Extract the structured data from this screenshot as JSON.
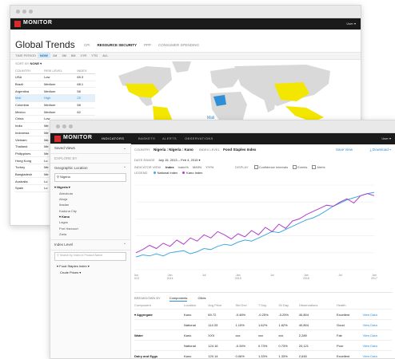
{
  "back": {
    "brand": "MONITOR",
    "user": "User ▾",
    "title": "Global Trends",
    "tabs": [
      "CPI",
      "RESOURCE SECURITY",
      "PPP",
      "CONSUMER SPENDING"
    ],
    "active_tab": "RESOURCE SECURITY",
    "time_label": "TIME PERIOD",
    "periods": [
      "NOW",
      "1M",
      "3M",
      "6M",
      "1YR",
      "YTD",
      "ALL"
    ],
    "sort_label": "SORT BY",
    "sort_value": "NONE ▾",
    "col_headers": [
      "COUNTRY",
      "RISK LEVEL",
      "INDEX"
    ],
    "rows": [
      {
        "country": "USA",
        "risk": "Low",
        "index": "69.3"
      },
      {
        "country": "Brazil",
        "risk": "Medium",
        "index": "68.1"
      },
      {
        "country": "Argentina",
        "risk": "Medium",
        "index": "58"
      },
      {
        "country": "Mali",
        "risk": "High",
        "index": "25"
      },
      {
        "country": "Colombia",
        "risk": "Medium",
        "index": "58"
      },
      {
        "country": "Mexico",
        "risk": "Medium",
        "index": "62"
      },
      {
        "country": "China",
        "risk": "Low",
        "index": ""
      },
      {
        "country": "India",
        "risk": "Me",
        "index": ""
      },
      {
        "country": "Indonesia",
        "risk": "Me",
        "index": ""
      },
      {
        "country": "Vietnam",
        "risk": "Me",
        "index": ""
      },
      {
        "country": "Thailand",
        "risk": "Me",
        "index": ""
      },
      {
        "country": "Philippines",
        "risk": "Me",
        "index": ""
      },
      {
        "country": "Hong Kong",
        "risk": "Lo",
        "index": ""
      },
      {
        "country": "Turkey",
        "risk": "Me",
        "index": ""
      },
      {
        "country": "Bangladesh",
        "risk": "Me",
        "index": ""
      },
      {
        "country": "Australia",
        "risk": "Lo",
        "index": ""
      },
      {
        "country": "Spain",
        "risk": "Lo",
        "index": ""
      }
    ],
    "map_label": "Mali"
  },
  "front": {
    "brand": "MONITOR",
    "nav": [
      "INDICATORS",
      "BASKETS",
      "ALERTS",
      "OBSERVATIONS"
    ],
    "active_nav": "INDICATORS",
    "user": "User ▾",
    "saved_views": "Saved Views",
    "explore_by": "EXPLORE BY",
    "geo_title": "Geographic Location",
    "geo_search": "Nigeria",
    "tree": [
      {
        "label": "▾ Nigeria ▾",
        "level": 0
      },
      {
        "label": "Abeokuta",
        "level": 1
      },
      {
        "label": "Abuja",
        "level": 1
      },
      {
        "label": "Ibadan",
        "level": 1
      },
      {
        "label": "Kaduna City",
        "level": 1
      },
      {
        "label": "▾ Kano",
        "level": 1
      },
      {
        "label": "Lagos",
        "level": 1
      },
      {
        "label": "Port Harcourt",
        "level": 1
      },
      {
        "label": "Zaria",
        "level": 1
      }
    ],
    "index_title": "Index Level",
    "index_search": "Search by Index in Product Name",
    "index_items": [
      "▾ Food Staples Index ▾",
      "Crude Prices ▾"
    ],
    "country_label": "COUNTRY",
    "country_value": "Nigeria : Nigeria : Kano",
    "index_label": "INDEX LEVEL",
    "index_value": "Food Staples Index",
    "save_view": "Save View",
    "download": "⤓ Download ▾",
    "date_label": "DATE RANGE",
    "date_value": "July 15, 2013 – Feb 4, 2015 ▾",
    "indicator_label": "INDICATOR VIEW",
    "indicator_opts": [
      "Index",
      "Index%",
      "M/M%",
      "Y/Y%"
    ],
    "display_label": "DISPLAY",
    "display_opts": [
      "Confidence Intervals",
      "Events",
      "Alerts"
    ],
    "legend_label": "LEGEND",
    "legend": [
      {
        "name": "National Index",
        "color": "#3fa9e0"
      },
      {
        "name": "Kano Index",
        "color": "#b13ec9"
      }
    ],
    "breakdown_label": "BREAKDOWN BY",
    "breakdown_tabs": [
      "Components",
      "Cities"
    ],
    "table_headers": [
      "Component",
      "Location",
      "Avg Price",
      "Std Dev",
      "7 Day",
      "30 Day",
      "Observations",
      "Health",
      ""
    ],
    "table_rows": [
      {
        "c": "▾ Aggregate",
        "l": "Kano",
        "p": "69.72",
        "s": "-0.46%",
        "d7": "-0.25%",
        "d30": "-0.25%",
        "o": "40,804",
        "h": "Excellent",
        "v": "View Data"
      },
      {
        "c": "",
        "l": "National",
        "p": "114.33",
        "s": "1.15%",
        "d7": "1.62%",
        "d30": "1.62%",
        "o": "40,804",
        "h": "Good",
        "v": "View Data"
      },
      {
        "c": "Water",
        "l": "Kano",
        "p": "XXX",
        "s": "xxx",
        "d7": "xxx",
        "d30": "xxx",
        "o": "2,289",
        "h": "Fair",
        "v": "View Data"
      },
      {
        "c": "",
        "l": "National",
        "p": "124.16",
        "s": "-0.34%",
        "d7": "0.73%",
        "d30": "0.73%",
        "o": "20,121",
        "h": "Poor",
        "v": "View Data"
      },
      {
        "c": "Dairy and Eggs",
        "l": "Kano",
        "p": "120.14",
        "s": "0.06%",
        "d7": "1.33%",
        "d30": "1.33%",
        "o": "2,645",
        "h": "Excellent",
        "v": "View Data"
      }
    ],
    "x_ticks": [
      "Jun\n2013",
      "Jan\n2014",
      "Jul",
      "Jan\n2015",
      "Jul",
      "Jan\n2016",
      "Jul",
      "Jan\n2017"
    ]
  },
  "chart_data": {
    "type": "line",
    "series": [
      {
        "name": "National Index",
        "color": "#3fa9e0",
        "values": [
          12,
          14,
          13,
          15,
          13,
          16,
          17,
          18,
          15,
          17,
          20,
          19,
          22,
          24,
          23,
          26,
          28,
          27,
          30,
          33,
          36,
          35,
          38,
          41,
          44,
          47,
          49,
          52,
          56,
          60,
          63,
          66,
          68,
          70,
          72,
          73
        ]
      },
      {
        "name": "Kano Index",
        "color": "#b13ec9",
        "values": [
          16,
          19,
          23,
          20,
          25,
          22,
          28,
          24,
          30,
          27,
          33,
          30,
          36,
          33,
          29,
          34,
          31,
          37,
          33,
          40,
          36,
          43,
          39,
          46,
          48,
          52,
          55,
          58,
          61,
          60,
          64,
          67,
          63,
          70,
          72,
          70
        ]
      }
    ]
  }
}
